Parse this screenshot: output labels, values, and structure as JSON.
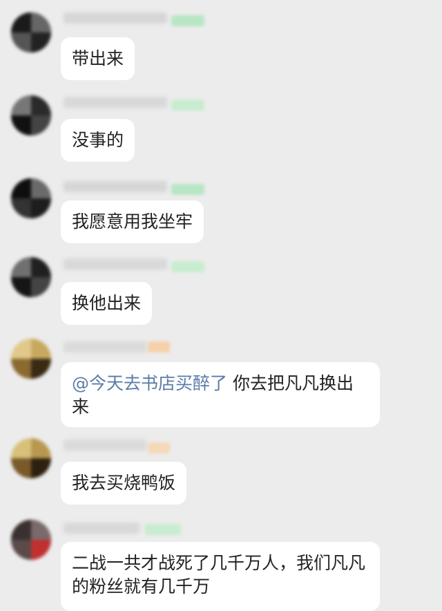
{
  "messages": [
    {
      "text": "带出来"
    },
    {
      "text": "没事的"
    },
    {
      "text": "我愿意用我坐牢"
    },
    {
      "text": "换他出来"
    },
    {
      "mention": "@今天去书店买醉了",
      "text": " 你去把凡凡换出来"
    },
    {
      "text": "我去买烧鸭饭"
    },
    {
      "text": "二战一共才战死了几千万人，我们凡凡的粉丝就有几千万"
    }
  ],
  "colors": {
    "background": "#ececec",
    "bubble": "#ffffff",
    "mention": "#5a7ba8",
    "badge_green": "#b8e6c4",
    "badge_orange": "#f5d0a8"
  }
}
